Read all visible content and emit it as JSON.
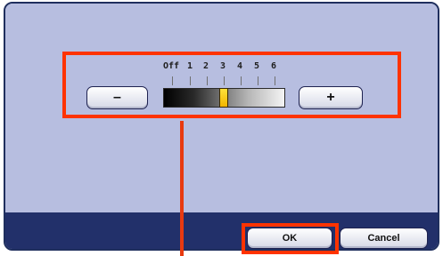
{
  "density_control": {
    "scale_labels": [
      "Off",
      "1",
      "2",
      "3",
      "4",
      "5",
      "6"
    ],
    "selected_level": "3",
    "minus_label": "–",
    "plus_label": "+"
  },
  "footer": {
    "ok_label": "OK",
    "cancel_label": "Cancel"
  },
  "colors": {
    "screen_background": "#b7bee0",
    "bottom_bar": "#22306a",
    "callout": "#ff3300",
    "marker": "#f2b500"
  }
}
